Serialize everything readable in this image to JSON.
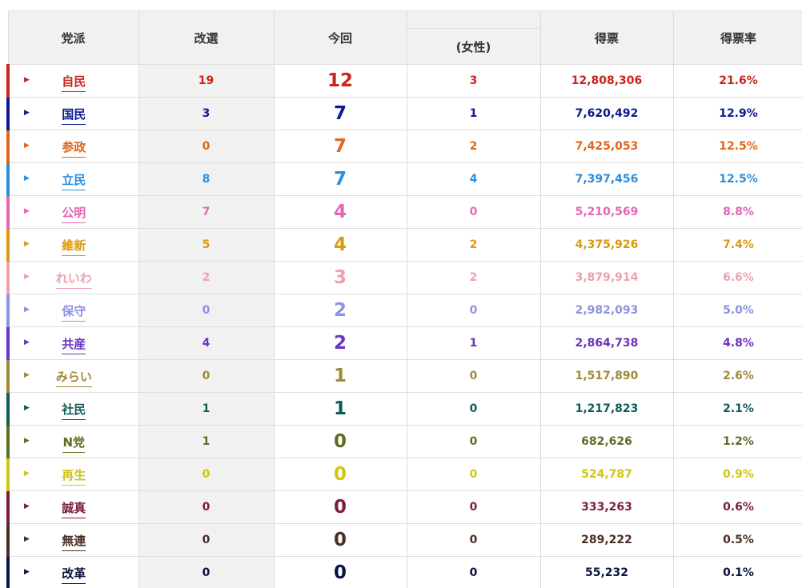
{
  "headers": {
    "party": "党派",
    "kaisen": "改選",
    "konkai": "今回",
    "women": "(女性)",
    "votes": "得票",
    "rate": "得票率"
  },
  "rows": [
    {
      "party": "自民",
      "kaisen": "19",
      "konkai": "12",
      "women": "3",
      "votes": "12,808,306",
      "rate": "21.6%",
      "color": "#c8261d"
    },
    {
      "party": "国民",
      "kaisen": "3",
      "konkai": "7",
      "women": "1",
      "votes": "7,620,492",
      "rate": "12.9%",
      "color": "#0b1a94"
    },
    {
      "party": "参政",
      "kaisen": "0",
      "konkai": "7",
      "women": "2",
      "votes": "7,425,053",
      "rate": "12.5%",
      "color": "#e2661b"
    },
    {
      "party": "立民",
      "kaisen": "8",
      "konkai": "7",
      "women": "4",
      "votes": "7,397,456",
      "rate": "12.5%",
      "color": "#2a8ee0"
    },
    {
      "party": "公明",
      "kaisen": "7",
      "konkai": "4",
      "women": "0",
      "votes": "5,210,569",
      "rate": "8.8%",
      "color": "#e566b5"
    },
    {
      "party": "維新",
      "kaisen": "5",
      "konkai": "4",
      "women": "2",
      "votes": "4,375,926",
      "rate": "7.4%",
      "color": "#d99a12"
    },
    {
      "party": "れいわ",
      "kaisen": "2",
      "konkai": "3",
      "women": "2",
      "votes": "3,879,914",
      "rate": "6.6%",
      "color": "#eea1ad"
    },
    {
      "party": "保守",
      "kaisen": "0",
      "konkai": "2",
      "women": "0",
      "votes": "2,982,093",
      "rate": "5.0%",
      "color": "#8c93e0"
    },
    {
      "party": "共産",
      "kaisen": "4",
      "konkai": "2",
      "women": "1",
      "votes": "2,864,738",
      "rate": "4.8%",
      "color": "#6b34c2"
    },
    {
      "party": "みらい",
      "kaisen": "0",
      "konkai": "1",
      "women": "0",
      "votes": "1,517,890",
      "rate": "2.6%",
      "color": "#a08a3a"
    },
    {
      "party": "社民",
      "kaisen": "1",
      "konkai": "1",
      "women": "0",
      "votes": "1,217,823",
      "rate": "2.1%",
      "color": "#0d5e57"
    },
    {
      "party": "N党",
      "kaisen": "1",
      "konkai": "0",
      "women": "0",
      "votes": "682,626",
      "rate": "1.2%",
      "color": "#5e6d21"
    },
    {
      "party": "再生",
      "kaisen": "0",
      "konkai": "0",
      "women": "0",
      "votes": "524,787",
      "rate": "0.9%",
      "color": "#cfc513"
    },
    {
      "party": "誠真",
      "kaisen": "0",
      "konkai": "0",
      "women": "0",
      "votes": "333,263",
      "rate": "0.6%",
      "color": "#7b1e3c"
    },
    {
      "party": "無連",
      "kaisen": "0",
      "konkai": "0",
      "women": "0",
      "votes": "289,222",
      "rate": "0.5%",
      "color": "#4a2e24"
    },
    {
      "party": "改革",
      "kaisen": "0",
      "konkai": "0",
      "women": "0",
      "votes": "55,232",
      "rate": "0.1%",
      "color": "#0a1440"
    }
  ]
}
